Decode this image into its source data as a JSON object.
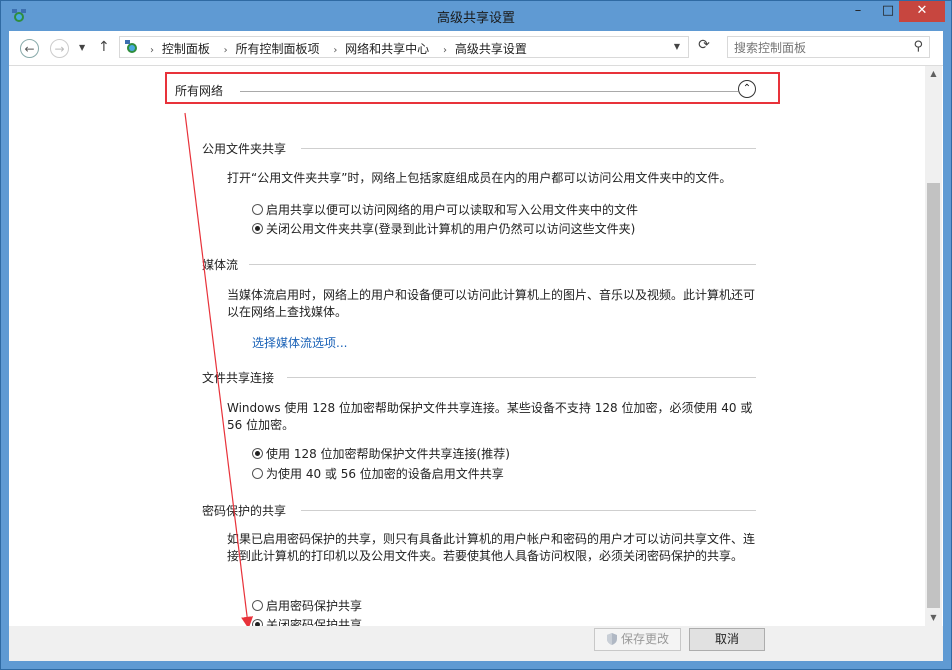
{
  "window": {
    "title": "高级共享设置",
    "minimize": "–",
    "maximize": "□",
    "close": "✕"
  },
  "nav": {
    "back": "←",
    "forward": "→",
    "recent": "▼",
    "up": "↑",
    "breadcrumbs": [
      "控制面板",
      "所有控制面板项",
      "网络和共享中心",
      "高级共享设置"
    ],
    "separator": "›",
    "dropdown": "▼",
    "refresh": "⟳",
    "search_placeholder": "搜索控制面板",
    "search_icon": "⚲"
  },
  "group": {
    "title": "所有网络",
    "collapse_glyph": "⌃"
  },
  "sections": {
    "public_folder": {
      "title": "公用文件夹共享",
      "description": "打开“公用文件夹共享”时，网络上包括家庭组成员在内的用户都可以访问公用文件夹中的文件。",
      "options": [
        "启用共享以便可以访问网络的用户可以读取和写入公用文件夹中的文件",
        "关闭公用文件夹共享(登录到此计算机的用户仍然可以访问这些文件夹)"
      ],
      "selected": 1
    },
    "media": {
      "title": "媒体流",
      "description": "当媒体流启用时，网络上的用户和设备便可以访问此计算机上的图片、音乐以及视频。此计算机还可以在网络上查找媒体。",
      "link": "选择媒体流选项..."
    },
    "file_sharing": {
      "title": "文件共享连接",
      "description": "Windows 使用 128 位加密帮助保护文件共享连接。某些设备不支持 128 位加密，必须使用 40 或 56 位加密。",
      "options": [
        "使用 128 位加密帮助保护文件共享连接(推荐)",
        "为使用 40 或 56 位加密的设备启用文件共享"
      ],
      "selected": 0
    },
    "password": {
      "title": "密码保护的共享",
      "description": "如果已启用密码保护的共享，则只有具备此计算机的用户帐户和密码的用户才可以访问共享文件、连接到此计算机的打印机以及公用文件夹。若要使其他人具备访问权限，必须关闭密码保护的共享。",
      "options": [
        "启用密码保护共享",
        "关闭密码保护共享"
      ],
      "selected": 1
    }
  },
  "footer": {
    "save": "保存更改",
    "cancel": "取消"
  },
  "colors": {
    "annotation": "#e8323a",
    "link": "#1a62b7",
    "titlebar": "#5f9ad3",
    "close": "#c7463f"
  }
}
